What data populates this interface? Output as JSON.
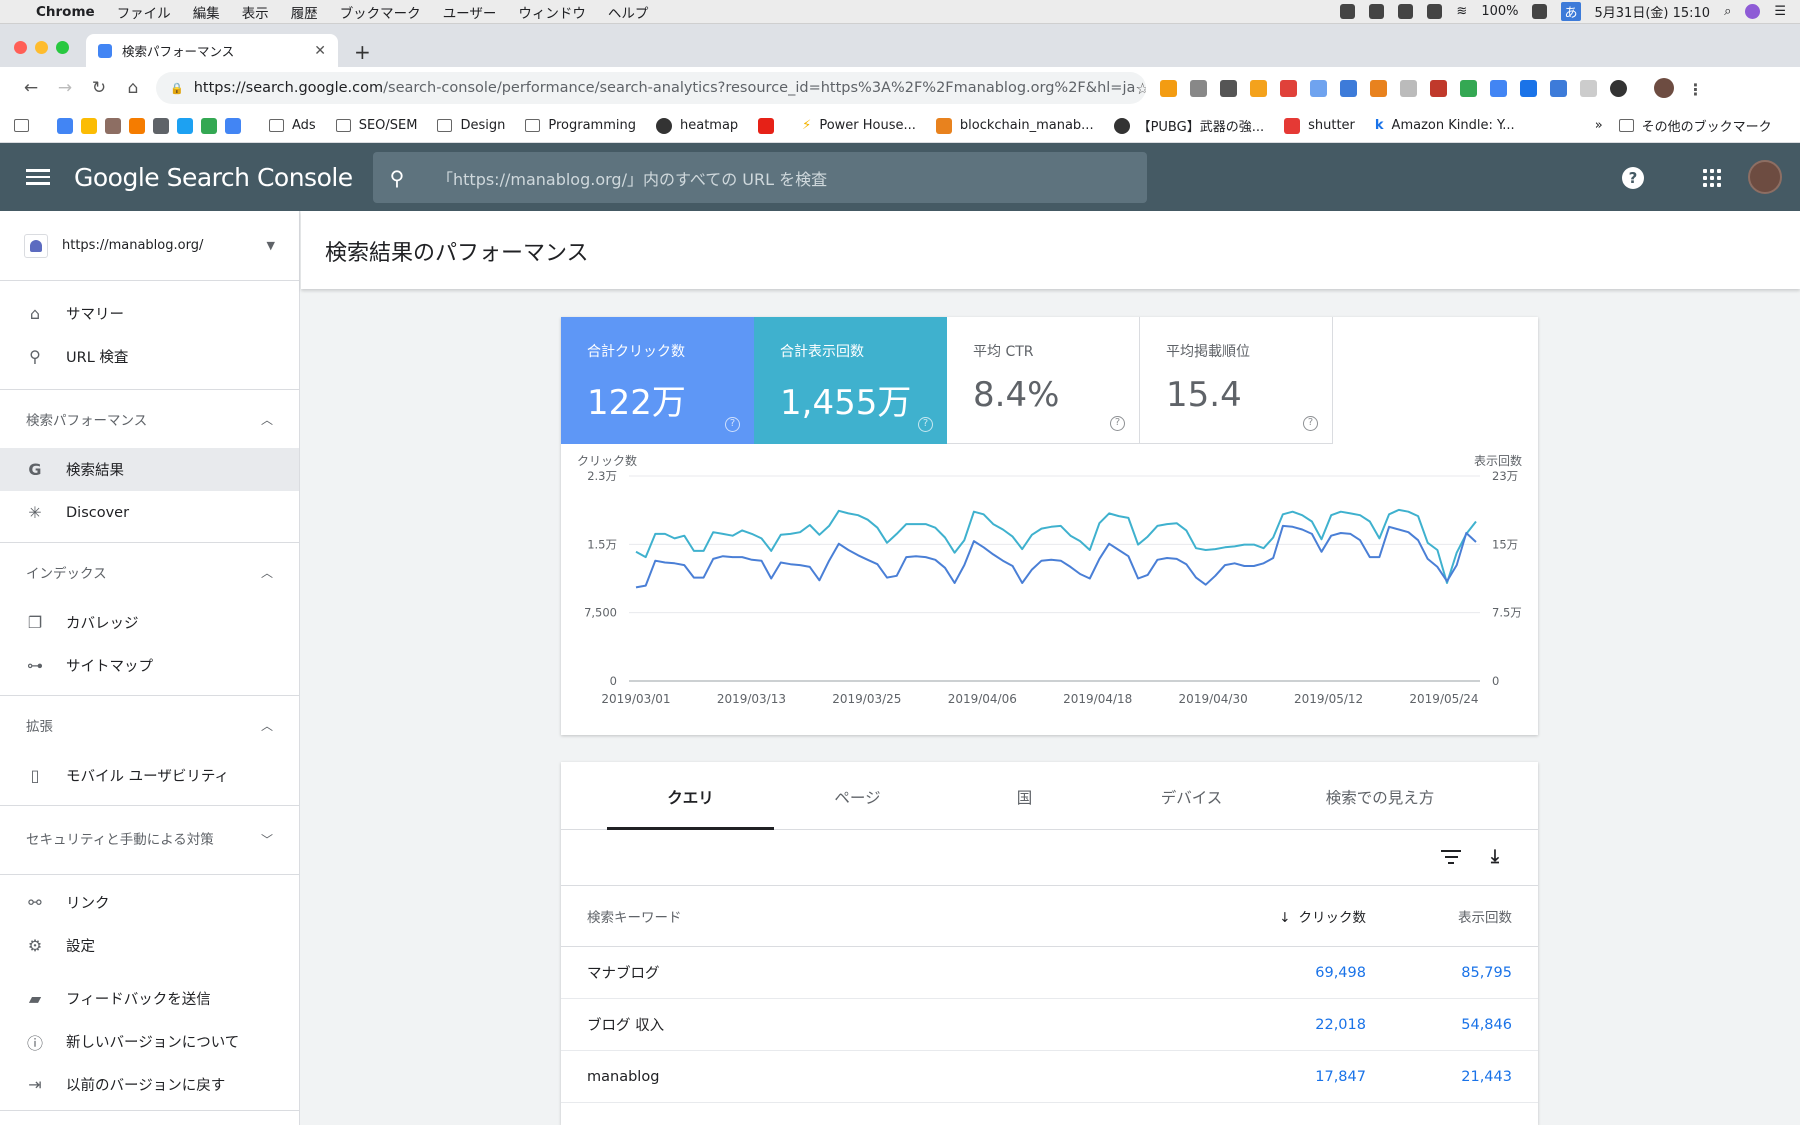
{
  "menubar": {
    "app": "Chrome",
    "items": [
      "ファイル",
      "編集",
      "表示",
      "履歴",
      "ブックマーク",
      "ユーザー",
      "ウィンドウ",
      "ヘルプ"
    ],
    "battery": "100%",
    "ime": "あ",
    "datetime": "5月31日(金) 15:10"
  },
  "browser": {
    "tab_title": "検索パフォーマンス",
    "url_host": "https://search.google.com",
    "url_path": "/search-console/performance/search-analytics?resource_id=https%3A%2F%2Fmanablog.org%2F&hl=ja"
  },
  "bookmarks": [
    "Ads",
    "SEO/SEM",
    "Design",
    "Programming",
    "heatmap",
    "Power House...",
    "blockchain_manab...",
    "【PUBG】武器の強...",
    "shutter",
    "Amazon Kindle: Y..."
  ],
  "bookmarks_more": "»",
  "bookmarks_other": "その他のブックマーク",
  "header": {
    "brand": "Google Search Console",
    "search_placeholder": "「https://manablog.org/」内のすべての URL を検査"
  },
  "sidebar": {
    "property": "https://manablog.org/",
    "top": [
      {
        "label": "サマリー",
        "icon": "home-icon"
      },
      {
        "label": "URL 検査",
        "icon": "search-icon"
      }
    ],
    "sec_perf": "検索パフォーマンス",
    "perf": [
      {
        "label": "検索結果",
        "icon": "google-g-icon"
      },
      {
        "label": "Discover",
        "icon": "asterisk-icon"
      }
    ],
    "sec_index": "インデックス",
    "index": [
      {
        "label": "カバレッジ",
        "icon": "coverage-icon"
      },
      {
        "label": "サイトマップ",
        "icon": "sitemap-icon"
      }
    ],
    "sec_ext": "拡張",
    "ext": [
      {
        "label": "モバイル ユーザビリティ",
        "icon": "phone-icon"
      }
    ],
    "sec_sec": "セキュリティと手動による対策",
    "misc": [
      {
        "label": "リンク",
        "icon": "links-icon"
      },
      {
        "label": "設定",
        "icon": "gear-icon"
      }
    ],
    "footer": [
      {
        "label": "フィードバックを送信",
        "icon": "feedback-icon"
      },
      {
        "label": "新しいバージョンについて",
        "icon": "info-icon"
      },
      {
        "label": "以前のバージョンに戻す",
        "icon": "exit-icon"
      }
    ]
  },
  "page_title": "検索結果のパフォーマンス",
  "metrics": [
    {
      "label": "合計クリック数",
      "value": "122万"
    },
    {
      "label": "合計表示回数",
      "value": "1,455万"
    },
    {
      "label": "平均 CTR",
      "value": "8.4%"
    },
    {
      "label": "平均掲載順位",
      "value": "15.4"
    }
  ],
  "colors": {
    "clicks": "#4a7fd6",
    "impressions": "#3fb1ce",
    "header": "#455a64"
  },
  "chart_data": {
    "type": "line",
    "ylabel_left": "クリック数",
    "ylabel_right": "表示回数",
    "y_left_ticks": [
      "2.3万",
      "1.5万",
      "7,500",
      "0"
    ],
    "y_right_ticks": [
      "23万",
      "15万",
      "7.5万",
      "0"
    ],
    "ylim_left": [
      0,
      23000
    ],
    "ylim_right": [
      0,
      230000
    ],
    "x_ticks": [
      "2019/03/01",
      "2019/03/13",
      "2019/03/25",
      "2019/04/06",
      "2019/04/18",
      "2019/04/30",
      "2019/05/12",
      "2019/05/24"
    ],
    "series": [
      {
        "name": "クリック数",
        "axis": "left",
        "values": [
          10500,
          10700,
          13500,
          13300,
          13200,
          13000,
          11600,
          11600,
          13700,
          14000,
          13900,
          13900,
          13600,
          13500,
          11500,
          13300,
          13100,
          13000,
          12800,
          11300,
          13500,
          15400,
          14700,
          14100,
          13600,
          13100,
          11600,
          11800,
          13900,
          14000,
          13900,
          13600,
          12700,
          11000,
          13000,
          15700,
          15000,
          14200,
          13500,
          12900,
          11000,
          12500,
          13500,
          13600,
          13500,
          12800,
          12000,
          11500,
          13700,
          15400,
          14700,
          14000,
          11500,
          11900,
          13600,
          13800,
          13700,
          13100,
          11600,
          10800,
          11800,
          13000,
          13200,
          12900,
          12900,
          13200,
          13800,
          17400,
          17300,
          17000,
          16500,
          14500,
          16300,
          16600,
          16500,
          15800,
          13900,
          13900,
          17300,
          17000,
          16700,
          15800,
          13700,
          12800,
          11200,
          13000,
          16600,
          15600
        ]
      },
      {
        "name": "表示回数",
        "axis": "right",
        "values": [
          145000,
          139000,
          165000,
          165000,
          160000,
          163000,
          146000,
          146000,
          167000,
          165000,
          163000,
          169000,
          165000,
          160000,
          146000,
          164000,
          165000,
          167000,
          175000,
          164000,
          174000,
          191000,
          188000,
          186000,
          181000,
          172000,
          155000,
          165000,
          176000,
          176000,
          176000,
          172000,
          161000,
          144000,
          158000,
          190000,
          187000,
          176000,
          170000,
          162000,
          148000,
          164000,
          171000,
          173000,
          174000,
          163000,
          157000,
          147000,
          177000,
          188000,
          185000,
          183000,
          153000,
          162000,
          174000,
          176000,
          177000,
          169000,
          149000,
          147000,
          148000,
          150000,
          151000,
          153000,
          153000,
          149000,
          161000,
          187000,
          190000,
          186000,
          179000,
          159000,
          186000,
          190000,
          188000,
          186000,
          179000,
          160000,
          187000,
          192000,
          190000,
          185000,
          155000,
          147000,
          110000,
          144000,
          165000,
          179000
        ]
      }
    ]
  },
  "table": {
    "tabs": [
      "クエリ",
      "ページ",
      "国",
      "デバイス",
      "検索での見え方"
    ],
    "headers": {
      "keyword": "検索キーワード",
      "sort_arrow": "↓",
      "clicks": "クリック数",
      "impressions": "表示回数"
    },
    "rows": [
      {
        "keyword": "マナブログ",
        "clicks": "69,498",
        "impressions": "85,795"
      },
      {
        "keyword": "ブログ 収入",
        "clicks": "22,018",
        "impressions": "54,846"
      },
      {
        "keyword": "manablog",
        "clicks": "17,847",
        "impressions": "21,443"
      }
    ]
  }
}
